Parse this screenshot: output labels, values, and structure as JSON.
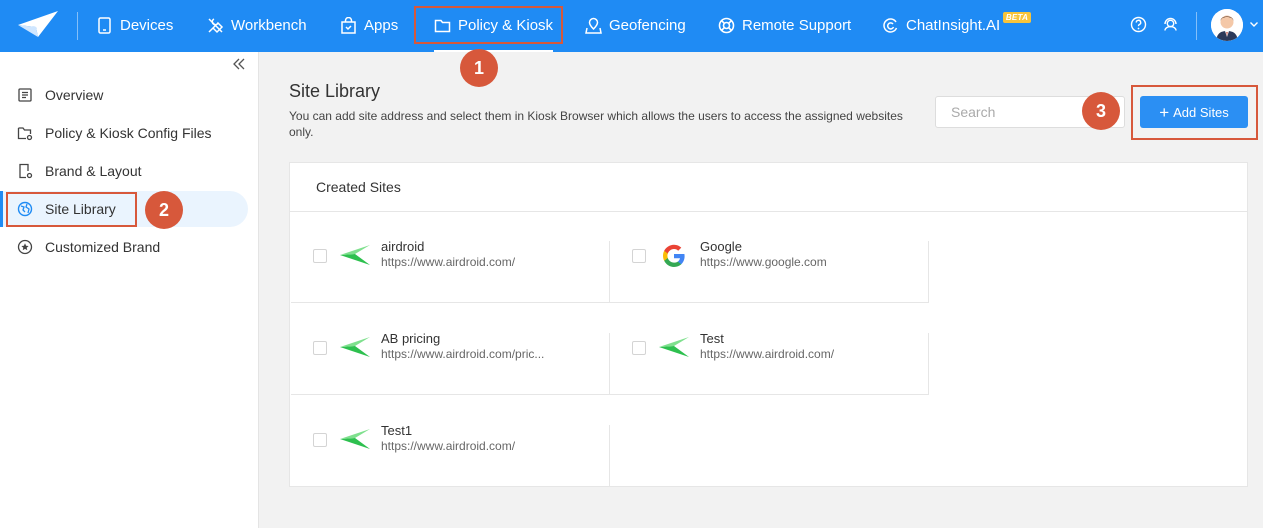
{
  "topnav": {
    "items": [
      {
        "label": "Devices",
        "icon": "tablet-icon"
      },
      {
        "label": "Workbench",
        "icon": "tools-icon"
      },
      {
        "label": "Apps",
        "icon": "app-bag-icon"
      },
      {
        "label": "Policy & Kiosk",
        "icon": "folder-icon",
        "active": true
      },
      {
        "label": "Geofencing",
        "icon": "map-pin-icon"
      },
      {
        "label": "Remote Support",
        "icon": "lifebuoy-icon"
      },
      {
        "label": "ChatInsight.AI",
        "icon": "chat-ai-icon",
        "badge": "BETA"
      }
    ],
    "accent": "#1f8bf4"
  },
  "sidebar": {
    "items": [
      {
        "label": "Overview",
        "icon": "list-icon"
      },
      {
        "label": "Policy & Kiosk Config Files",
        "icon": "folder-gear-icon"
      },
      {
        "label": "Brand & Layout",
        "icon": "phone-gear-icon"
      },
      {
        "label": "Site Library",
        "icon": "globe-icon",
        "active": true
      },
      {
        "label": "Customized Brand",
        "icon": "star-circle-icon"
      }
    ]
  },
  "main": {
    "title": "Site Library",
    "description": "You can add site address and select them in Kiosk Browser which allows the users to access the assigned websites only.",
    "search_placeholder": "Search",
    "add_button": "Add Sites",
    "card_title": "Created Sites",
    "sites": [
      {
        "name": "airdroid",
        "url": "https://www.airdroid.com/",
        "icon": "airdroid-icon"
      },
      {
        "name": "Google",
        "url": "https://www.google.com",
        "icon": "google-icon"
      },
      {
        "name": "AB pricing",
        "url": "https://www.airdroid.com/pric...",
        "icon": "airdroid-icon"
      },
      {
        "name": "Test",
        "url": "https://www.airdroid.com/",
        "icon": "airdroid-icon"
      },
      {
        "name": "Test1",
        "url": "https://www.airdroid.com/",
        "icon": "airdroid-icon"
      }
    ]
  },
  "annotations": {
    "badges": [
      "1",
      "2",
      "3"
    ],
    "color": "#d7583b"
  }
}
